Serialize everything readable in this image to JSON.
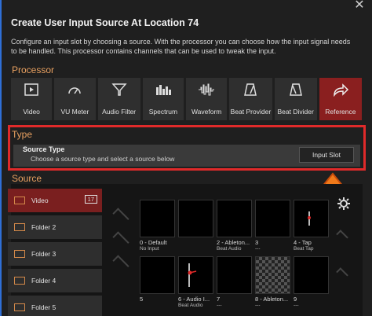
{
  "window": {
    "title": "Create User Input Source At Location 74",
    "description": "Configure an input slot by choosing a source. With the processor you can choose how the input signal needs to be handled. This processor contains channels that can be used to tweak the input.",
    "close_icon": "x-icon"
  },
  "processor": {
    "label": "Processor",
    "buttons": [
      {
        "label": "Video",
        "icon": "video-icon",
        "selected": false
      },
      {
        "label": "VU Meter",
        "icon": "gauge-icon",
        "selected": false
      },
      {
        "label": "Audio Filter",
        "icon": "filter-icon",
        "selected": false
      },
      {
        "label": "Spectrum",
        "icon": "spectrum-icon",
        "selected": false
      },
      {
        "label": "Waveform",
        "icon": "waveform-icon",
        "selected": false
      },
      {
        "label": "Beat Provider",
        "icon": "metronome-icon",
        "selected": false
      },
      {
        "label": "Beat Divider",
        "icon": "metronome-icon",
        "selected": false
      },
      {
        "label": "Reference",
        "icon": "share-arrow-icon",
        "selected": true
      }
    ]
  },
  "type": {
    "label": "Type",
    "title": "Source Type",
    "subtitle": "Choose a source type and select a source below",
    "button": "Input Slot"
  },
  "source": {
    "label": "Source",
    "folders": [
      {
        "label": "Video",
        "count": "17",
        "selected": true
      },
      {
        "label": "Folder 2",
        "count": "",
        "selected": false
      },
      {
        "label": "Folder 3",
        "count": "",
        "selected": false
      },
      {
        "label": "Folder 4",
        "count": "",
        "selected": false
      },
      {
        "label": "Folder 5",
        "count": "",
        "selected": false
      }
    ],
    "slots": [
      {
        "label": "",
        "sub": ""
      },
      {
        "label": "",
        "sub": ""
      },
      {
        "label": "",
        "sub": ""
      },
      {
        "label": "",
        "sub": ""
      },
      {
        "label": "",
        "sub": ""
      },
      {
        "label": "0 - Default",
        "sub": "No Input"
      },
      {
        "label": "2 - Ableton...",
        "sub": "Beat Audio"
      },
      {
        "label": "3",
        "sub": "---"
      },
      {
        "label": "4 - Tap",
        "sub": "Beat Tap"
      },
      {
        "label": "5",
        "sub": ""
      },
      {
        "label": "6 - Audio I...",
        "sub": "Beat Audio"
      },
      {
        "label": "7",
        "sub": "---"
      },
      {
        "label": "8 - Ableton...",
        "sub": "---"
      },
      {
        "label": "9",
        "sub": "---"
      }
    ]
  },
  "colors": {
    "accent": "#e8a060",
    "selected": "#8a1f1f",
    "highlight_box": "#e02a2a",
    "arrow": "#f07a1a"
  }
}
